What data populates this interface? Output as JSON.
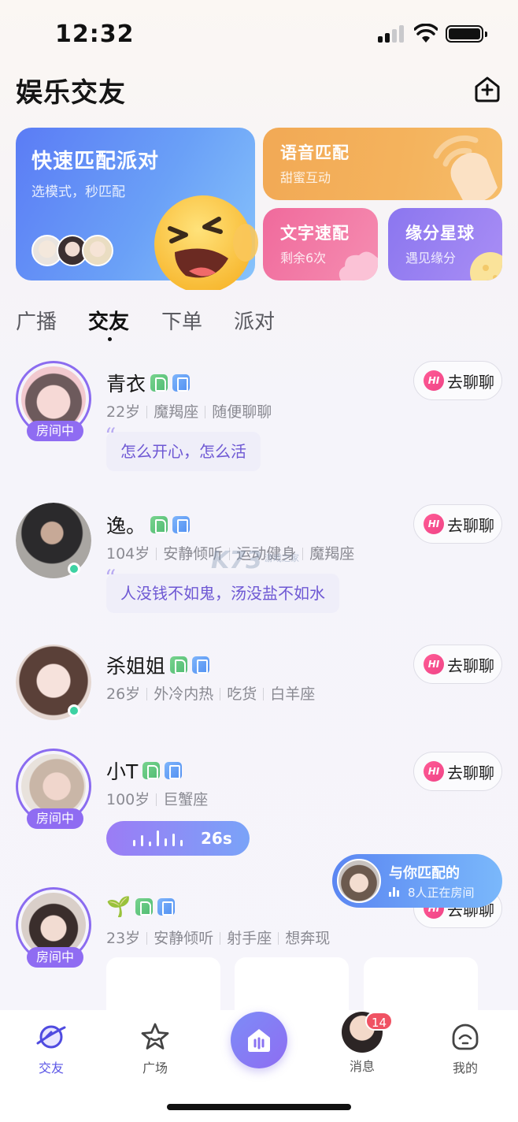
{
  "status": {
    "time": "12:32"
  },
  "header": {
    "title": "娱乐交友"
  },
  "features": {
    "party": {
      "title": "快速匹配派对",
      "sub": "选模式，秒匹配"
    },
    "voice": {
      "title": "语音匹配",
      "sub": "甜蜜互动"
    },
    "text": {
      "title": "文字速配",
      "sub": "剩余6次"
    },
    "planet": {
      "title": "缘分星球",
      "sub": "遇见缘分"
    }
  },
  "tabs": [
    "广播",
    "交友",
    "下单",
    "派对"
  ],
  "active_tab": "交友",
  "users": [
    {
      "name": "青衣",
      "age": "22岁",
      "tags": [
        "魔羯座",
        "随便聊聊"
      ],
      "quote": "怎么开心，怎么活",
      "badge": "房间中",
      "action": "去聊聊"
    },
    {
      "name": "逸。",
      "age": "104岁",
      "tags": [
        "安静倾听",
        "运动健身",
        "魔羯座"
      ],
      "quote": "人没钱不如鬼，汤没盐不如水",
      "action": "去聊聊"
    },
    {
      "name": "杀姐姐",
      "age": "26岁",
      "tags": [
        "外冷内热",
        "吃货",
        "白羊座"
      ],
      "action": "去聊聊"
    },
    {
      "name": "小T",
      "age": "100岁",
      "tags": [
        "巨蟹座"
      ],
      "voice": "26s",
      "badge": "房间中",
      "action": "去聊聊"
    },
    {
      "name": "🌱",
      "age": "23岁",
      "tags": [
        "安静倾听",
        "射手座",
        "想奔现"
      ],
      "badge": "房间中",
      "action": "去聊聊"
    }
  ],
  "hi_label": "HI",
  "match_float": {
    "title": "与你匹配的",
    "sub": "8人正在房间"
  },
  "watermark": {
    "main": "K73",
    "sub": "游戏之家"
  },
  "nav": {
    "friends": "交友",
    "square": "广场",
    "messages": "消息",
    "messages_badge": "14",
    "mine": "我的"
  },
  "colors": {
    "accent": "#8f6cf2",
    "online": "#3dd2a3",
    "hi": "#f04487",
    "badge": "#f05263"
  }
}
